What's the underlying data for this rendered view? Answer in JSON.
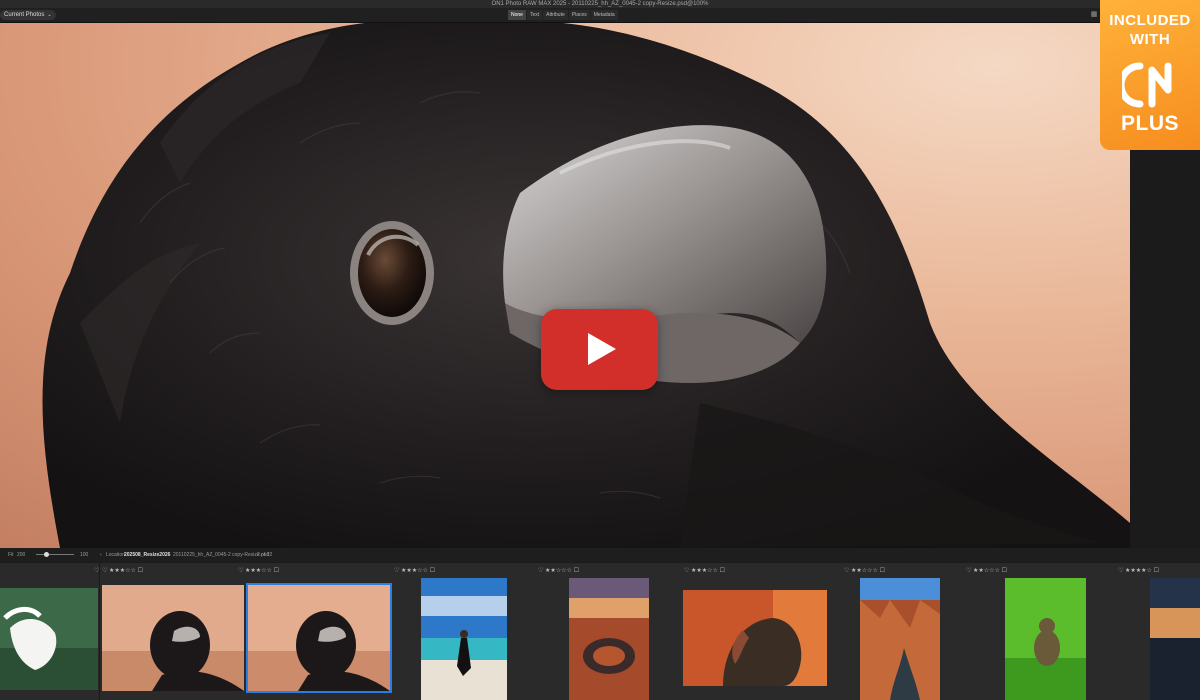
{
  "window": {
    "title": "ON1 Photo RAW MAX 2025 - 20110225_hh_AZ_0045-2 copy-Resize.psd@100%"
  },
  "topbar": {
    "filter_label": "Current Photos",
    "tabs": [
      {
        "label": "None",
        "active": true
      },
      {
        "label": "Text",
        "active": false
      },
      {
        "label": "Attribute",
        "active": false
      },
      {
        "label": "Places",
        "active": false
      },
      {
        "label": "Metadata",
        "active": false
      }
    ],
    "icons": [
      "grid-view-icon",
      "compare-view-icon",
      "brightness-icon"
    ]
  },
  "badge": {
    "line1": "INCLUDED",
    "line2": "WITH",
    "logo": "ON1",
    "line3": "PLUS",
    "color": "#f7931e"
  },
  "play_button": {
    "color": "#d32f2a"
  },
  "statusbar": {
    "fit_label": "Fit",
    "zoom_value": "200",
    "zoom_max": "100",
    "location_prefix": "Location",
    "location_folder": "202508_Resize2026",
    "file_name": "20110225_hh_AZ_0045-2 copy-Resize.psd",
    "position": "2 of 22"
  },
  "filmstrip": [
    {
      "rating": "★★★☆☆",
      "subject": "egret"
    },
    {
      "rating": "★★★☆☆",
      "subject": "raven"
    },
    {
      "rating": "★★★☆☆",
      "subject": "raven-selected"
    },
    {
      "rating": "★★★☆☆",
      "subject": "beach"
    },
    {
      "rating": "★★☆☆☆",
      "subject": "canyon-bend"
    },
    {
      "rating": "★★★☆☆",
      "subject": "vulture"
    },
    {
      "rating": "★★☆☆☆",
      "subject": "canyon-stream"
    },
    {
      "rating": "★★☆☆☆",
      "subject": "baboon"
    },
    {
      "rating": "★★★★☆",
      "subject": "sunset"
    }
  ]
}
